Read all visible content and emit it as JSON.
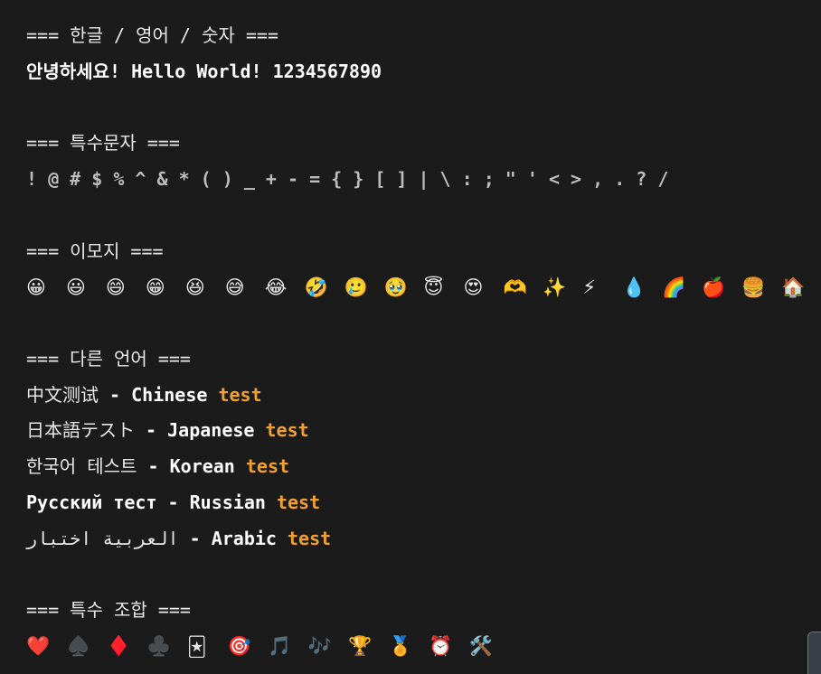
{
  "colors": {
    "background": "#1b1b1b",
    "text": "#e8e8e8",
    "accent": "#f0a030"
  },
  "sections": {
    "mixed": {
      "header": "=== 한글 / 영어 / 숫자 ===",
      "line": "안녕하세요! Hello World! 1234567890"
    },
    "special": {
      "header": "=== 특수문자 ===",
      "line": "! @ # $ % ^ & * ( ) _ + - = { } [ ] | \\ : ; \" ' < > , . ? /"
    },
    "emoji": {
      "header": "=== 이모지 ===",
      "items": [
        "😀",
        "😃",
        "😄",
        "😁",
        "😆",
        "😅",
        "😂",
        "🤣",
        "🥲",
        "🥹",
        "😇",
        "😍",
        "🫶",
        "✨",
        "⚡",
        "💧",
        "🌈",
        "🍎",
        "🍔",
        "🏠"
      ]
    },
    "languages": {
      "header": "=== 다른 언어 ===",
      "rows": [
        {
          "native": "中文测试",
          "sep": " - ",
          "name": "Chinese",
          "word": "test"
        },
        {
          "native": "日本語テスト",
          "sep": " - ",
          "name": "Japanese",
          "word": "test"
        },
        {
          "native": "한국어 테스트",
          "sep": " - ",
          "name": "Korean",
          "word": "test"
        },
        {
          "native": "Русский тест",
          "sep": " - ",
          "name": "Russian",
          "word": "test"
        },
        {
          "native": "العربية اختبار",
          "sep": " - ",
          "name": "Arabic",
          "word": "test"
        }
      ]
    },
    "combo": {
      "header": "=== 특수 조합 ===",
      "items": [
        "❤️",
        "♠️",
        "♦️",
        "♣️",
        "🃏",
        "🎯",
        "🎵",
        "🎶",
        "🏆",
        "🏅",
        "⏰",
        "🛠️"
      ]
    }
  }
}
